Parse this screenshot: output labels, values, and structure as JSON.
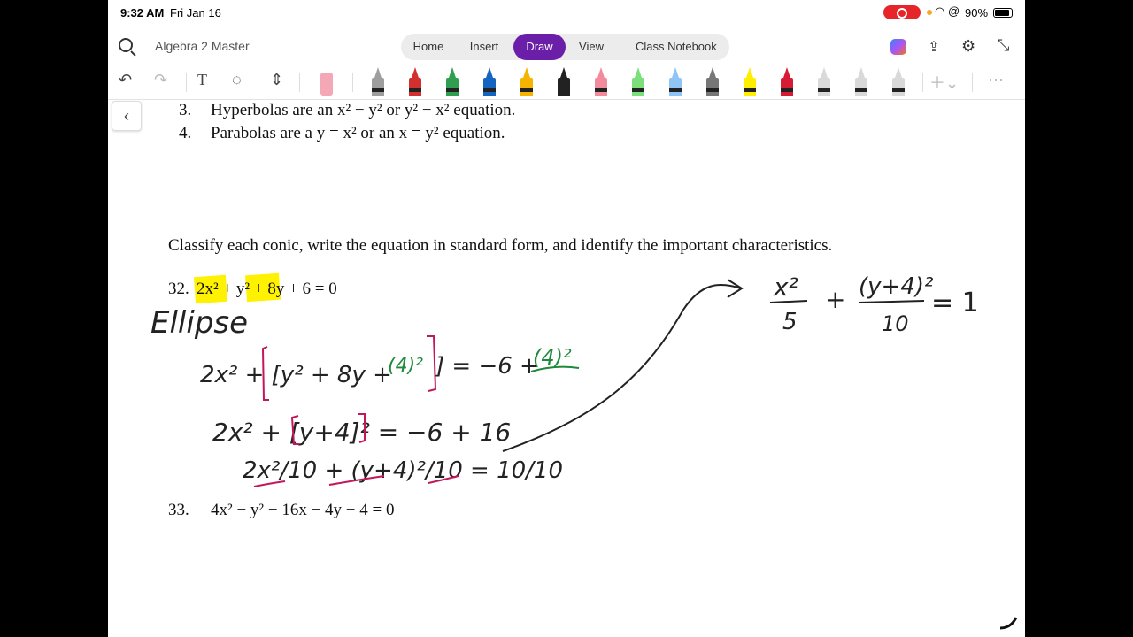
{
  "status_bar": {
    "time": "9:32 AM",
    "date": "Fri Jan 16",
    "battery": "90%"
  },
  "header": {
    "notebook_title": "Algebra 2 Master",
    "tabs": [
      {
        "label": "Home"
      },
      {
        "label": "Insert"
      },
      {
        "label": "Draw",
        "active": true
      },
      {
        "label": "View"
      }
    ],
    "class_notebook": "Class Notebook"
  },
  "toolbar": {
    "tools": [
      "undo-icon",
      "redo-icon",
      "text-icon",
      "lasso-icon",
      "add-space-icon",
      "eraser-icon",
      "pen-icon"
    ],
    "pen_colors": [
      "#9e9e9e",
      "#d32f2f",
      "#2e9e4f",
      "#1565c0",
      "#f5b400",
      "#222222",
      "#f28b9b",
      "#7be07b",
      "#8ec5f5",
      "#777777",
      "#ffee00",
      "#d81b35",
      "#d9d9d9",
      "#d9d9d9",
      "#d9d9d9"
    ]
  },
  "page": {
    "typed": {
      "line3_num": "3.",
      "line3_text": "Hyperbolas are an x² − y² or y² − x² equation.",
      "line4_num": "4.",
      "line4_text": "Parabolas are a y = x² or an x = y² equation.",
      "instruction": "Classify each conic, write the equation in standard form, and identify the important characteristics.",
      "p32_num": "32.",
      "p32_eq": "2x² + y² + 8y + 6 = 0",
      "p33_num": "33.",
      "p33_eq": "4x² − y² − 16x − 4y − 4 = 0"
    },
    "handwriting": {
      "conic": "Ellipse",
      "step1_left": "2x² + [y² + 8y +",
      "step1_add_left": "(4)²",
      "step1_rest": "] = −6 +",
      "step1_add_right": "(4)²",
      "step2": "2x² + [y+4]² = −6 + 16",
      "step3": "2x²/10 + (y+4)²/10 = 10/10",
      "result_num1": "x²",
      "result_den1": "5",
      "result_plus": "+",
      "result_num2": "(y+4)²",
      "result_den2": "10",
      "result_eq": "= 1"
    },
    "ink_colors": {
      "black": "#222222",
      "green": "#1e8a3c",
      "red": "#c2185b",
      "highlight": "#fff200"
    }
  }
}
